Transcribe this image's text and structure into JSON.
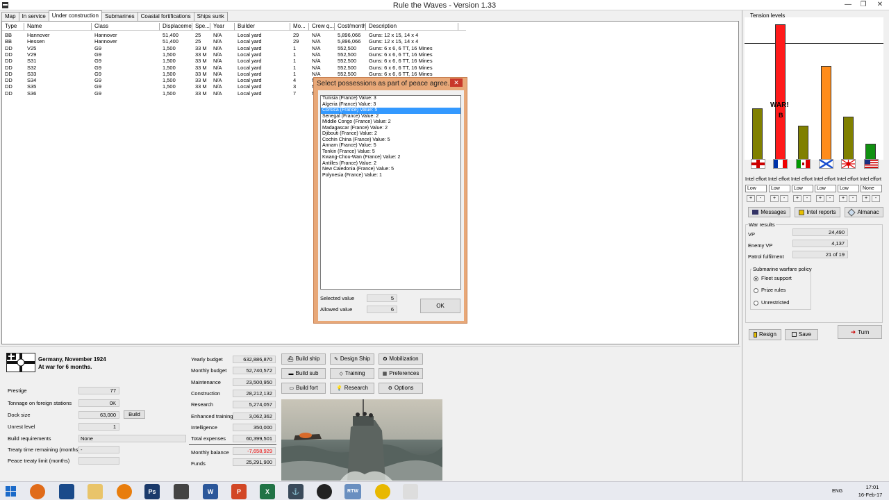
{
  "window": {
    "title": "Rule the Waves - Version 1.33"
  },
  "tabs": [
    "Map",
    "In service",
    "Under construction",
    "Submarines",
    "Coastal fortifications",
    "Ships sunk"
  ],
  "table": {
    "headers": [
      "Type",
      "Name",
      "Class",
      "Displacement",
      "Spe...",
      "Year",
      "Builder",
      "Mo...",
      "Crew q...",
      "Cost/month",
      "Description"
    ],
    "rows": [
      [
        "BB",
        "Hannover",
        "Hannover",
        "51,400",
        "25",
        "N/A",
        "Local yard",
        "29",
        "N/A",
        "5,896,066",
        "Guns: 12 x 15, 14 x 4"
      ],
      [
        "BB",
        "Hessen",
        "Hannover",
        "51,400",
        "25",
        "N/A",
        "Local yard",
        "29",
        "N/A",
        "5,896,066",
        "Guns: 12 x 15, 14 x 4"
      ],
      [
        "DD",
        "V25",
        "G9",
        "1,500",
        "33 M",
        "N/A",
        "Local yard",
        "1",
        "N/A",
        "552,500",
        "Guns: 6 x 6, 6 TT, 16 Mines"
      ],
      [
        "DD",
        "V29",
        "G9",
        "1,500",
        "33 M",
        "N/A",
        "Local yard",
        "1",
        "N/A",
        "552,500",
        "Guns: 6 x 6, 6 TT, 16 Mines"
      ],
      [
        "DD",
        "S31",
        "G9",
        "1,500",
        "33 M",
        "N/A",
        "Local yard",
        "1",
        "N/A",
        "552,500",
        "Guns: 6 x 6, 6 TT, 16 Mines"
      ],
      [
        "DD",
        "S32",
        "G9",
        "1,500",
        "33 M",
        "N/A",
        "Local yard",
        "1",
        "N/A",
        "552,500",
        "Guns: 6 x 6, 6 TT, 16 Mines"
      ],
      [
        "DD",
        "S33",
        "G9",
        "1,500",
        "33 M",
        "N/A",
        "Local yard",
        "1",
        "N/A",
        "552,500",
        "Guns: 6 x 6, 6 TT, 16 Mines"
      ],
      [
        "DD",
        "S34",
        "G9",
        "1,500",
        "33 M",
        "N/A",
        "Local yard",
        "4",
        "N/A",
        "",
        ""
      ],
      [
        "DD",
        "S35",
        "G9",
        "1,500",
        "33 M",
        "N/A",
        "Local yard",
        "3",
        "N/A",
        "",
        ""
      ],
      [
        "DD",
        "S36",
        "G9",
        "1,500",
        "33 M",
        "N/A",
        "Local yard",
        "7",
        "N/A",
        "",
        ""
      ]
    ]
  },
  "dialog": {
    "title": "Select possessions as part of peace agree...",
    "close": "✕",
    "items": [
      "Tunisia (France) Value: 3",
      "Algeria (France) Value: 3",
      "Corsica (France) Value: 5",
      "Senegal (France) Value: 2",
      "Middle Congo (France) Value: 2",
      "Madagascar (France) Value: 2",
      "Djibouti (France) Value: 2",
      "Cochin China (France) Value: 5",
      "Annam (France) Value: 5",
      "Tonkin (France) Value: 5",
      "Kwang-Chou-Wan (France) Value: 2",
      "Antilles (France) Value: 2",
      "New Caledonia (France) Value: 5",
      "Polynesia (France) Value: 1"
    ],
    "selected_index": 2,
    "selected_value_label": "Selected value",
    "selected_value": "5",
    "allowed_value_label": "Allowed value",
    "allowed_value": "6",
    "ok_label": "OK"
  },
  "tension": {
    "title": "Tension levels",
    "war_label": "WAR!",
    "war_sub": "B",
    "levels": [
      0.38,
      1.0,
      0.25,
      0.69,
      0.32,
      0.12
    ],
    "colors": [
      "#808000",
      "#ff1a1a",
      "#808000",
      "#ff8c1a",
      "#808000",
      "#109010"
    ],
    "nations": [
      "UK",
      "France",
      "Italy",
      "Russia",
      "Japan",
      "USA"
    ],
    "intel_label": "Intel effort",
    "intel_values": [
      "Low",
      "Low",
      "Low",
      "Low",
      "Low",
      "None"
    ]
  },
  "right_buttons": {
    "messages": "Messages",
    "intel_reports": "Intel reports",
    "almanac": "Almanac"
  },
  "war_results": {
    "title": "War results",
    "vp_label": "VP",
    "vp": "24,490",
    "enemy_vp_label": "Enemy VP",
    "enemy_vp": "4,137",
    "patrol_label": "Patrol fulfilment",
    "patrol": "21 of 19"
  },
  "submarine_policy": {
    "title": "Submarine warfare policy",
    "options": [
      "Fleet support",
      "Prize rules",
      "Unrestricted"
    ],
    "selected": 0
  },
  "bottom_right_buttons": {
    "resign": "Resign",
    "save": "Save",
    "turn": "Turn"
  },
  "nation": {
    "line1": "Germany, November 1924",
    "line2": "At war for 6 months."
  },
  "stats": [
    {
      "label": "Prestige",
      "value": "77"
    },
    {
      "label": "Tonnage on foreign stations",
      "value": "0K"
    },
    {
      "label": "Dock size",
      "value": "63,000"
    },
    {
      "label": "Unrest level",
      "value": "1"
    },
    {
      "label": "Build requirements",
      "value": "None"
    },
    {
      "label": "Treaty time remaining (months)",
      "value": "-"
    },
    {
      "label": "Peace treaty limit (months)",
      "value": ""
    }
  ],
  "build_label": "Build",
  "budget": [
    {
      "label": "Yearly budget",
      "value": "632,886,870"
    },
    {
      "label": "Monthly budget",
      "value": "52,740,572"
    },
    {
      "label": "Maintenance",
      "value": "23,500,950"
    },
    {
      "label": "Construction",
      "value": "28,212,132"
    },
    {
      "label": "Research",
      "value": "5,274,057"
    },
    {
      "label": "Enhanced training",
      "value": "3,062,362"
    },
    {
      "label": "Intelligence",
      "value": "350,000"
    },
    {
      "label": "Total expenses",
      "value": "60,399,501"
    }
  ],
  "monthly_balance": {
    "label": "Monthly balance",
    "value": "-7,658,929"
  },
  "funds": {
    "label": "Funds",
    "value": "25,291,900"
  },
  "actions": [
    "Build ship",
    "Design Ship",
    "Mobilization",
    "Build sub",
    "Training",
    "Preferences",
    "Build fort",
    "Research",
    "Options"
  ],
  "taskbar": {
    "time": "17:01",
    "date": "16-Feb-17",
    "lang": "ENG",
    "rtw_label": "RTW"
  }
}
